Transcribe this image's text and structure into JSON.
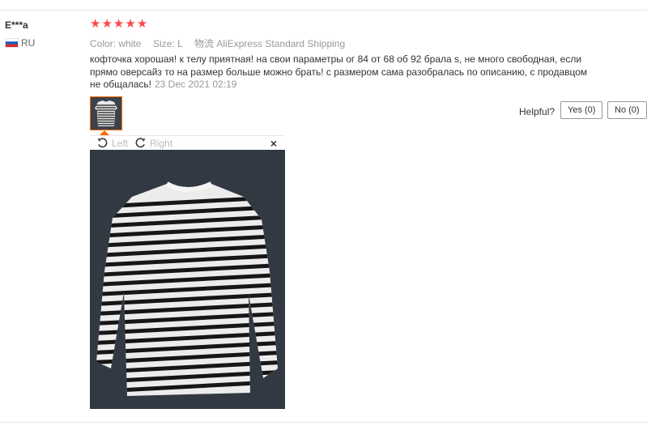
{
  "review": {
    "user_name": "E***a",
    "country_code": "RU",
    "rating": 5,
    "stars": [
      "★",
      "★",
      "★",
      "★",
      "★"
    ],
    "color_label": "Color:",
    "color_value": "white",
    "size_label": "Size:",
    "size_value": "L",
    "shipping_label": "物流",
    "shipping_value": "AliExpress Standard Shipping",
    "text": "кофточка хорошая! к телу приятная! на свои параметры ог 84 от 68 об 92 брала s, не много свободная, если прямо оверсайз то на размер больше можно брать! с размером сама разобралась по описанию, с продавцом не общалась!",
    "date": "23 Dec 2021 02:19"
  },
  "helpful": {
    "label": "Helpful?",
    "yes_label": "Yes (0)",
    "no_label": "No (0)"
  },
  "viewer": {
    "rotate_left_label": "Left",
    "rotate_right_label": "Right",
    "close_glyph": "×"
  },
  "colors": {
    "star": "#ff4747",
    "accent": "#ff6a00"
  }
}
